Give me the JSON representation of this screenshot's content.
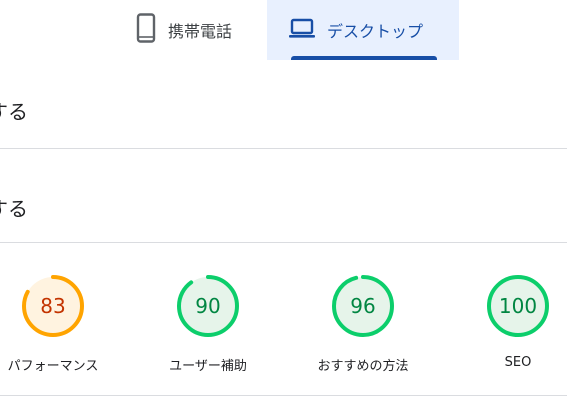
{
  "tabs": {
    "mobile_label": "携帯電話",
    "desktop_label": "デスクトップ",
    "active": "desktop"
  },
  "rows": [
    {
      "text": "する"
    },
    {
      "text": "する"
    }
  ],
  "scores": [
    {
      "label": "パフォーマンス",
      "value": "83",
      "fraction": 0.83,
      "color": "#ffa400",
      "fill": "#fff3e0",
      "text_color": "#c33300"
    },
    {
      "label": "ユーザー補助",
      "value": "90",
      "fraction": 0.9,
      "color": "#0cce6b",
      "fill": "#e6f4ea",
      "text_color": "#018642"
    },
    {
      "label": "おすすめの方法",
      "value": "96",
      "fraction": 0.96,
      "color": "#0cce6b",
      "fill": "#e6f4ea",
      "text_color": "#018642"
    },
    {
      "label": "SEO",
      "value": "100",
      "fraction": 1.0,
      "color": "#0cce6b",
      "fill": "#e6f4ea",
      "text_color": "#018642"
    }
  ],
  "colors": {
    "accent": "#174ea6",
    "active_tab_bg": "#e8f0fe",
    "divider": "#dadce0"
  },
  "icons": {
    "mobile": "phone-icon",
    "desktop": "laptop-icon"
  }
}
